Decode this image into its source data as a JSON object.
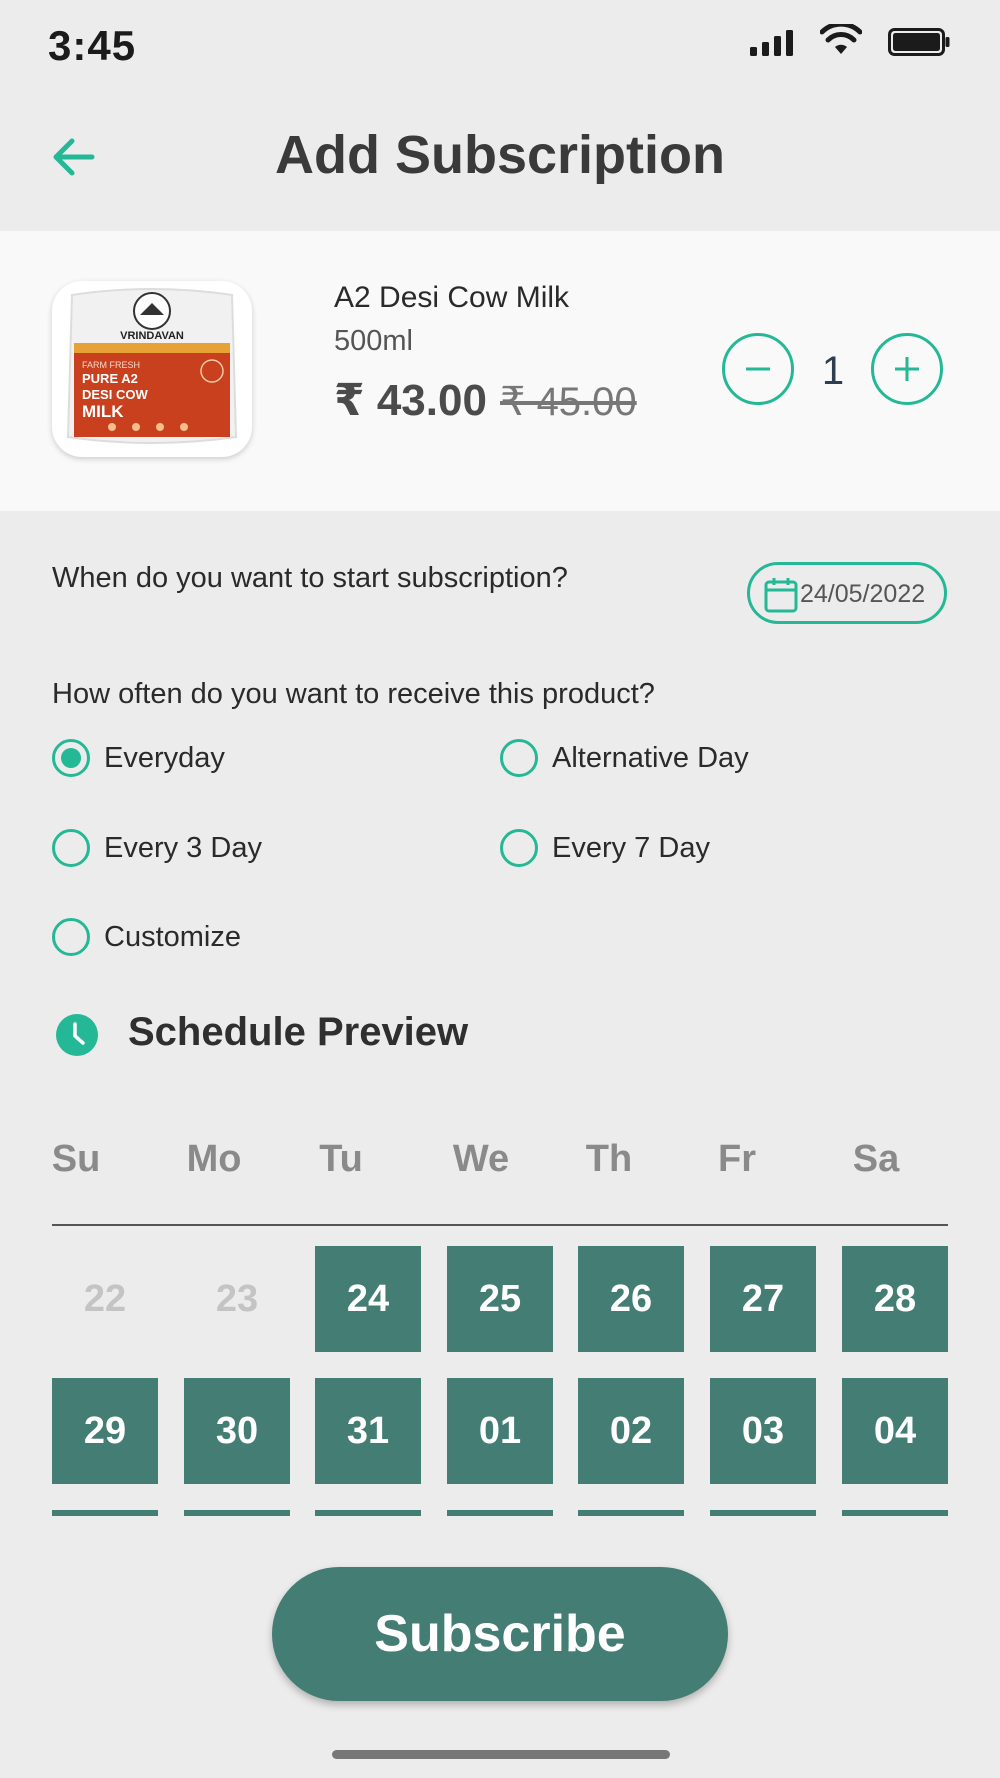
{
  "status_bar": {
    "time": "3:45"
  },
  "header": {
    "title": "Add Subscription",
    "back_icon": "arrow-left-icon",
    "accent": "#25b896"
  },
  "product": {
    "name": "A2 Desi Cow Milk",
    "size": "500ml",
    "price": "₹ 43.00",
    "mrp": "₹ 45.00",
    "quantity": "1",
    "image": {
      "brand": "VRINDAVAN",
      "tagline": "FARM FRESH",
      "line1": "PURE A2",
      "line2": "DESI COW",
      "line3": "MILK",
      "pack_color": "#c8401e"
    }
  },
  "start": {
    "question": "When do you want to start subscription?",
    "date": "24/05/2022"
  },
  "frequency": {
    "question": "How often do you want to receive this product?",
    "options": [
      {
        "label": "Everyday",
        "checked": true
      },
      {
        "label": "Alternative Day",
        "checked": false
      },
      {
        "label": "Every 3 Day",
        "checked": false
      },
      {
        "label": "Every 7 Day",
        "checked": false
      },
      {
        "label": "Customize",
        "checked": false
      }
    ]
  },
  "schedule": {
    "title": "Schedule Preview",
    "weekdays": [
      "Su",
      "Mo",
      "Tu",
      "We",
      "Th",
      "Fr",
      "Sa"
    ],
    "week1": [
      {
        "d": "22",
        "on": false
      },
      {
        "d": "23",
        "on": false
      },
      {
        "d": "24",
        "on": true
      },
      {
        "d": "25",
        "on": true
      },
      {
        "d": "26",
        "on": true
      },
      {
        "d": "27",
        "on": true
      },
      {
        "d": "28",
        "on": true
      }
    ],
    "week2": [
      {
        "d": "29",
        "on": true
      },
      {
        "d": "30",
        "on": true
      },
      {
        "d": "31",
        "on": true
      },
      {
        "d": "01",
        "on": true
      },
      {
        "d": "02",
        "on": true
      },
      {
        "d": "03",
        "on": true
      },
      {
        "d": "04",
        "on": true
      }
    ],
    "week3_partial": [
      true,
      true,
      true,
      true,
      true,
      true,
      true
    ],
    "selected_color": "#437d74"
  },
  "actions": {
    "subscribe_label": "Subscribe"
  }
}
